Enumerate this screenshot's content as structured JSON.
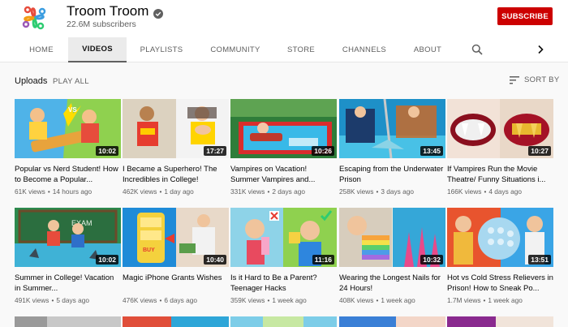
{
  "channel": {
    "name": "Troom Troom",
    "subscribers": "22.6M subscribers",
    "subscribe_label": "SUBSCRIBE"
  },
  "tabs": [
    {
      "label": "HOME"
    },
    {
      "label": "VIDEOS"
    },
    {
      "label": "PLAYLISTS"
    },
    {
      "label": "COMMUNITY"
    },
    {
      "label": "STORE"
    },
    {
      "label": "CHANNELS"
    },
    {
      "label": "ABOUT"
    }
  ],
  "uploads": {
    "label": "Uploads",
    "play_all": "PLAY ALL",
    "sort_by": "SORT BY"
  },
  "videos": [
    {
      "title": "Popular vs Nerd Student! How to Become a Popular...",
      "views": "61K views",
      "age": "14 hours ago",
      "duration": "10:02"
    },
    {
      "title": "I Became a Superhero! The Incredibles in College!",
      "views": "462K views",
      "age": "1 day ago",
      "duration": "17:27"
    },
    {
      "title": "Vampires on Vacation! Summer Vampires and...",
      "views": "331K views",
      "age": "2 days ago",
      "duration": "10:26"
    },
    {
      "title": "Escaping from the Underwater Prison",
      "views": "258K views",
      "age": "3 days ago",
      "duration": "13:45"
    },
    {
      "title": "If Vampires Run the Movie Theatre/ Funny Situations i...",
      "views": "166K views",
      "age": "4 days ago",
      "duration": "10:27"
    },
    {
      "title": "Summer in College! Vacation in Summer...",
      "views": "491K views",
      "age": "5 days ago",
      "duration": "10:02"
    },
    {
      "title": "Magic iPhone Grants Wishes",
      "views": "476K views",
      "age": "6 days ago",
      "duration": "10:40"
    },
    {
      "title": "Is it Hard to Be a Parent? Teenager Hacks",
      "views": "359K views",
      "age": "1 week ago",
      "duration": "11:16"
    },
    {
      "title": "Wearing the Longest Nails for 24 Hours!",
      "views": "408K views",
      "age": "1 week ago",
      "duration": "10:32"
    },
    {
      "title": "Hot vs Cold Stress Relievers in Prison! How to Sneak Po...",
      "views": "1.7M views",
      "age": "1 week ago",
      "duration": "13:51"
    }
  ],
  "colors": {
    "subscribe": "#cc0000",
    "tab_active_bg": "#ebebeb",
    "page_bg": "#f9f9f9"
  },
  "icons": [
    "troom-troom-logo",
    "verified-icon",
    "search-icon",
    "chevron-right-icon",
    "sort-icon"
  ]
}
